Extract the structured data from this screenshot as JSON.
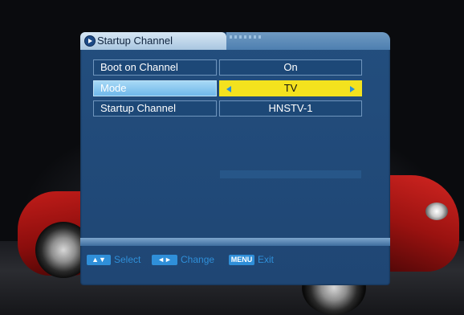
{
  "window": {
    "title": "Startup Channel"
  },
  "settings": [
    {
      "label": "Boot on Channel",
      "value": "On"
    },
    {
      "label": "Mode",
      "value": "TV"
    },
    {
      "label": "Startup Channel",
      "value": "HNSTV-1"
    }
  ],
  "footer": {
    "select_key": "▲▼",
    "select_label": "Select",
    "change_key": "◄►",
    "change_label": "Change",
    "menu_key": "MENU",
    "exit_label": "Exit"
  },
  "colors": {
    "panel": "#234e7e",
    "highlight_label": "#8ccaf0",
    "highlight_value": "#f3e21e",
    "hint_text": "#2f8fd9"
  }
}
